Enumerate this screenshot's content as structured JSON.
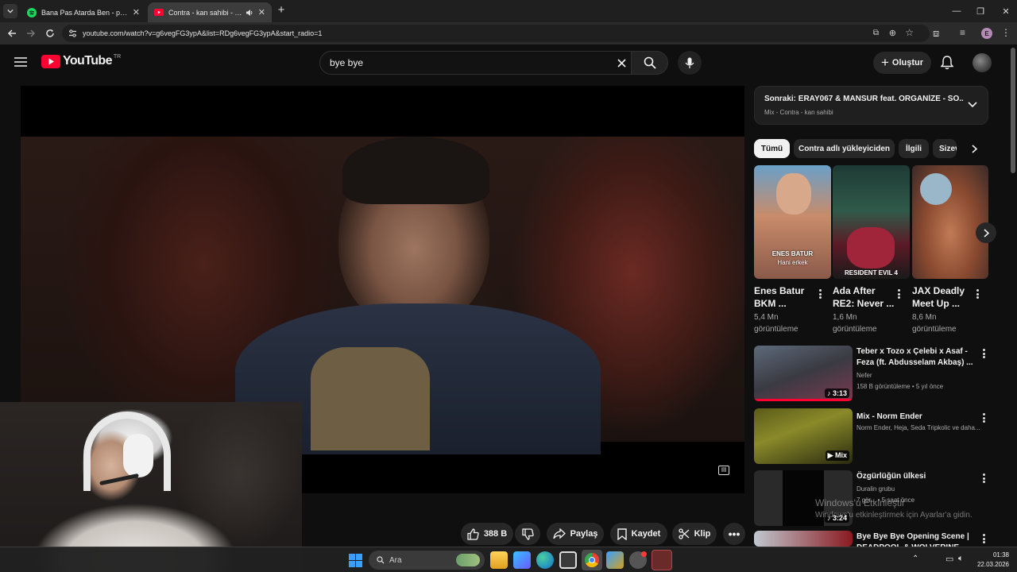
{
  "browser": {
    "tabs": [
      {
        "title": "Bana Pas Atarda Ben - playlist b",
        "icon": "spotify-icon"
      },
      {
        "title": "Contra - kan sahibi - YouTube",
        "icon": "youtube-icon"
      }
    ],
    "url": "youtube.com/watch?v=g6vegFG3ypA&list=RDg6vegFG3ypA&start_radio=1",
    "profile_letter": "E"
  },
  "youtube": {
    "logo_text": "YouTube",
    "region": "TR",
    "search_value": "bye bye",
    "create_label": "Oluştur"
  },
  "actions": {
    "likes": "388 B",
    "share": "Paylaş",
    "save": "Kaydet",
    "clip": "Klip"
  },
  "up_next": {
    "title": "Sonraki: ERAY067 & MANSUR feat. ORGANİZE - SO...",
    "subtitle": "Mix - Contra - kan sahibi"
  },
  "chips": [
    "Tümü",
    "Contra adlı yükleyiciden",
    "İlgili",
    "Sizev"
  ],
  "shorts": [
    {
      "title": "Enes Batur BKM ...",
      "views": "5,4 Mn görüntüleme",
      "overlay1": "ENES BATUR",
      "overlay2": "Hani erkek"
    },
    {
      "title": "Ada After RE2: Never ...",
      "views": "1,6 Mn görüntüleme",
      "overlay1": "RESIDENT EVIL 4"
    },
    {
      "title": "JAX Deadly Meet Up ...",
      "views": "8,6 Mn görüntüleme"
    }
  ],
  "videos": [
    {
      "title": "Teber x Tozo x Çelebi x Asaf - Feza (ft. Abdusselam Akbaş) ...",
      "channel": "Nefer",
      "meta": "158 B görüntüleme • 5 yıl önce",
      "badge": "3:13"
    },
    {
      "title": "Mix - Norm Ender",
      "channel": "Norm Ender, Heja, Seda Tripkolic ve daha...",
      "meta": "",
      "badge": "Mix"
    },
    {
      "title": "Özgürlüğün ülkesi",
      "channel": "Duralin grubu",
      "meta": "7 gör... • 5 saat önce",
      "badge": "3:24"
    },
    {
      "title": "Bye Bye Bye Opening Scene | DEADPOOL & WOLVERINE",
      "channel": "",
      "meta": "",
      "badge": ""
    }
  ],
  "windows": {
    "activation_title": "Windows'u Etkinleştir",
    "activation_sub": "Windows'u etkinleştirmek için Ayarlar'a gidin.",
    "search_placeholder": "Ara",
    "time": "01:38",
    "date": "22.03.2026"
  },
  "colors": {
    "bg": "#0f0f0f",
    "youtube_red": "#ff0033",
    "chip_active": "#f1f1f1",
    "windows_blue": "#3aa0ff"
  }
}
